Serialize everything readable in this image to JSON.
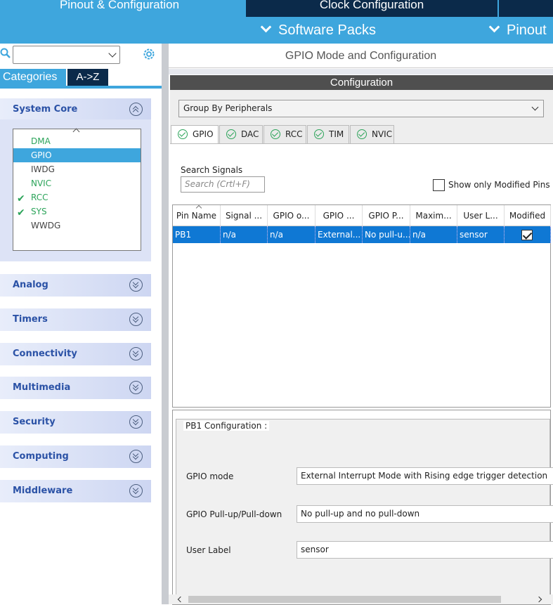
{
  "top_tabs": {
    "pinout": "Pinout & Configuration",
    "clock": "Clock Configuration"
  },
  "toolbar": {
    "software_packs": "Software Packs",
    "pinout": "Pinout"
  },
  "left": {
    "search_value": "",
    "tab_categories": "Categories",
    "tab_az": "A->Z",
    "sections": {
      "system_core": "System Core",
      "analog": "Analog",
      "timers": "Timers",
      "connectivity": "Connectivity",
      "multimedia": "Multimedia",
      "security": "Security",
      "computing": "Computing",
      "middleware": "Middleware"
    },
    "system_core_items": [
      {
        "label": "DMA",
        "check": ""
      },
      {
        "label": "GPIO",
        "check": ""
      },
      {
        "label": "IWDG",
        "check": ""
      },
      {
        "label": "NVIC",
        "check": ""
      },
      {
        "label": "RCC",
        "check": "✔"
      },
      {
        "label": "SYS",
        "check": "✔"
      },
      {
        "label": "WWDG",
        "check": ""
      }
    ]
  },
  "right": {
    "title": "GPIO Mode and Configuration",
    "config_header": "Configuration",
    "group_select": "Group By Peripherals",
    "tabs": [
      "GPIO",
      "DAC",
      "RCC",
      "TIM",
      "NVIC"
    ],
    "search_signals_label": "Search Signals",
    "search_placeholder": "Search (Crtl+F)",
    "show_modified_label": "Show only Modified Pins",
    "table": {
      "headers": [
        "Pin Name",
        "Signal ...",
        "GPIO o...",
        "GPIO ...",
        "GPIO P...",
        "Maxim...",
        "User L...",
        "Modified"
      ],
      "row": [
        "PB1",
        "n/a",
        "n/a",
        "External...",
        "No pull-u...",
        "n/a",
        "sensor",
        ""
      ],
      "modified_checked": true
    },
    "pin_config": {
      "title": "PB1 Configuration :",
      "gpio_mode_label": "GPIO mode",
      "gpio_mode_value": "External Interrupt Mode with Rising edge trigger detection",
      "pull_label": "GPIO Pull-up/Pull-down",
      "pull_value": "No pull-up and no pull-down",
      "user_label_label": "User Label",
      "user_label_value": "sensor"
    }
  },
  "colors": {
    "accent": "#3ea6dd",
    "dark_tab": "#0b2a4a",
    "selected_row": "#0f78d4",
    "ok_green": "#2ca45a",
    "section_text": "#2b52a6"
  }
}
